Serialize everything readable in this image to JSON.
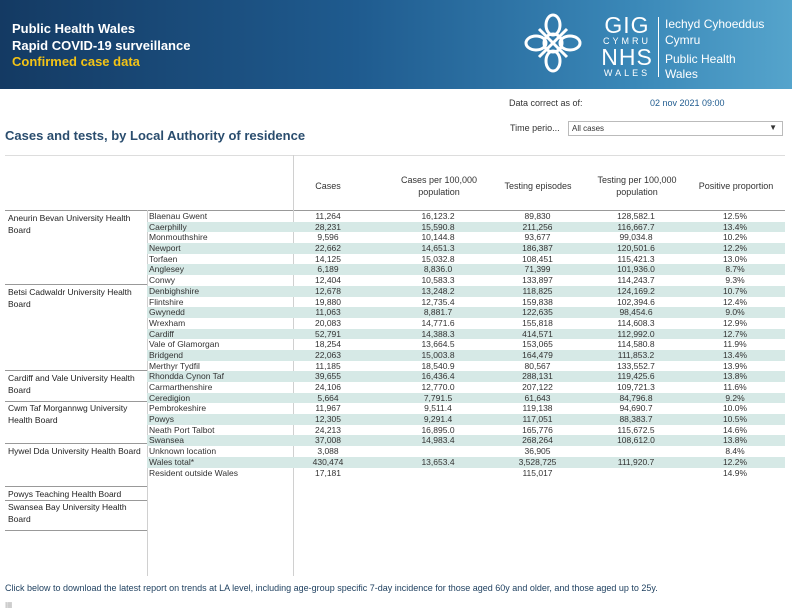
{
  "header": {
    "line1": "Public Health Wales",
    "line2": "Rapid COVID-19 surveillance",
    "line3": "Confirmed case data",
    "logo_gig": "GIG",
    "logo_cymru": "CYMRU",
    "logo_nhs": "NHS",
    "logo_wales": "WALES",
    "logo_t1": "Iechyd Cyhoeddus",
    "logo_t2": "Cymru",
    "logo_t3": "Public Health",
    "logo_t4": "Wales",
    "accent": "#f3c316"
  },
  "controls": {
    "data_correct_label": "Data correct as of:",
    "data_correct_value": "02 nov 2021 09:00",
    "period_label": "Time perio...",
    "period_value": "All cases"
  },
  "section_title": "Cases and tests, by Local Authority of residence",
  "columns": {
    "cases": "Cases",
    "rate": "Cases per 100,000 population",
    "tests": "Testing episodes",
    "trate": "Testing per 100,000 population",
    "pos": "Positive proportion"
  },
  "health_boards": [
    "Aneurin Bevan University Health Board",
    "Betsi Cadwaldr University Health Board",
    "Cardiff and Vale University Health Board",
    "Cwm Taf Morgannwg University Health Board",
    "Hywel Dda University Health Board",
    "Powys Teaching Health Board",
    "Swansea Bay University Health Board"
  ],
  "rows": [
    {
      "la": "Blaenau Gwent",
      "cases": "11,264",
      "rate": "16,123.2",
      "tests": "89,830",
      "trate": "128,582.1",
      "pos": "12.5%"
    },
    {
      "la": "Caerphilly",
      "cases": "28,231",
      "rate": "15,590.8",
      "tests": "211,256",
      "trate": "116,667.7",
      "pos": "13.4%"
    },
    {
      "la": "Monmouthshire",
      "cases": "9,596",
      "rate": "10,144.8",
      "tests": "93,677",
      "trate": "99,034.8",
      "pos": "10.2%"
    },
    {
      "la": "Newport",
      "cases": "22,662",
      "rate": "14,651.3",
      "tests": "186,387",
      "trate": "120,501.6",
      "pos": "12.2%"
    },
    {
      "la": "Torfaen",
      "cases": "14,125",
      "rate": "15,032.8",
      "tests": "108,451",
      "trate": "115,421.3",
      "pos": "13.0%"
    },
    {
      "la": "Anglesey",
      "cases": "6,189",
      "rate": "8,836.0",
      "tests": "71,399",
      "trate": "101,936.0",
      "pos": "8.7%"
    },
    {
      "la": "Conwy",
      "cases": "12,404",
      "rate": "10,583.3",
      "tests": "133,897",
      "trate": "114,243.7",
      "pos": "9.3%"
    },
    {
      "la": "Denbighshire",
      "cases": "12,678",
      "rate": "13,248.2",
      "tests": "118,825",
      "trate": "124,169.2",
      "pos": "10.7%"
    },
    {
      "la": "Flintshire",
      "cases": "19,880",
      "rate": "12,735.4",
      "tests": "159,838",
      "trate": "102,394.6",
      "pos": "12.4%"
    },
    {
      "la": "Gwynedd",
      "cases": "11,063",
      "rate": "8,881.7",
      "tests": "122,635",
      "trate": "98,454.6",
      "pos": "9.0%"
    },
    {
      "la": "Wrexham",
      "cases": "20,083",
      "rate": "14,771.6",
      "tests": "155,818",
      "trate": "114,608.3",
      "pos": "12.9%"
    },
    {
      "la": "Cardiff",
      "cases": "52,791",
      "rate": "14,388.3",
      "tests": "414,571",
      "trate": "112,992.0",
      "pos": "12.7%"
    },
    {
      "la": "Vale of Glamorgan",
      "cases": "18,254",
      "rate": "13,664.5",
      "tests": "153,065",
      "trate": "114,580.8",
      "pos": "11.9%"
    },
    {
      "la": "Bridgend",
      "cases": "22,063",
      "rate": "15,003.8",
      "tests": "164,479",
      "trate": "111,853.2",
      "pos": "13.4%"
    },
    {
      "la": "Merthyr Tydfil",
      "cases": "11,185",
      "rate": "18,540.9",
      "tests": "80,567",
      "trate": "133,552.7",
      "pos": "13.9%"
    },
    {
      "la": "Rhondda Cynon Taf",
      "cases": "39,655",
      "rate": "16,436.4",
      "tests": "288,131",
      "trate": "119,425.6",
      "pos": "13.8%"
    },
    {
      "la": "Carmarthenshire",
      "cases": "24,106",
      "rate": "12,770.0",
      "tests": "207,122",
      "trate": "109,721.3",
      "pos": "11.6%"
    },
    {
      "la": "Ceredigion",
      "cases": "5,664",
      "rate": "7,791.5",
      "tests": "61,643",
      "trate": "84,796.8",
      "pos": "9.2%"
    },
    {
      "la": "Pembrokeshire",
      "cases": "11,967",
      "rate": "9,511.4",
      "tests": "119,138",
      "trate": "94,690.7",
      "pos": "10.0%"
    },
    {
      "la": "Powys",
      "cases": "12,305",
      "rate": "9,291.4",
      "tests": "117,051",
      "trate": "88,383.7",
      "pos": "10.5%"
    },
    {
      "la": "Neath Port Talbot",
      "cases": "24,213",
      "rate": "16,895.0",
      "tests": "165,776",
      "trate": "115,672.5",
      "pos": "14.6%"
    },
    {
      "la": "Swansea",
      "cases": "37,008",
      "rate": "14,983.4",
      "tests": "268,264",
      "trate": "108,612.0",
      "pos": "13.8%"
    },
    {
      "la": "Unknown location",
      "cases": "3,088",
      "rate": "",
      "tests": "36,905",
      "trate": "",
      "pos": "8.4%"
    },
    {
      "la": "Wales total*",
      "cases": "430,474",
      "rate": "13,653.4",
      "tests": "3,528,725",
      "trate": "111,920.7",
      "pos": "12.2%"
    },
    {
      "la": "Resident outside Wales",
      "cases": "17,181",
      "rate": "",
      "tests": "115,017",
      "trate": "",
      "pos": "14.9%"
    }
  ],
  "footnote": "Click below to download the latest report on trends at LA level, including age-group specific 7-day incidence for those aged 60y and older, and those aged up to 25y."
}
